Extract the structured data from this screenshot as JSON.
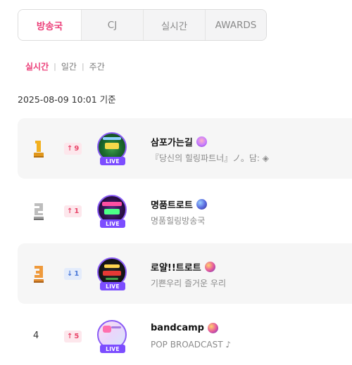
{
  "tabs": [
    {
      "label": "방송국",
      "active": true
    },
    {
      "label": "CJ",
      "active": false
    },
    {
      "label": "실시간",
      "active": false
    },
    {
      "label": "AWARDS",
      "active": false
    }
  ],
  "periods": [
    {
      "label": "실시간",
      "active": true
    },
    {
      "label": "일간",
      "active": false
    },
    {
      "label": "주간",
      "active": false
    }
  ],
  "period_separator": "|",
  "timestamp": "2025-08-09 10:01 기준",
  "live_label": "LIVE",
  "colors": {
    "accent": "#ec407a",
    "rank_up": "#e8476a",
    "rank_down": "#4a78d8",
    "live_badge": "#7c4dff",
    "medal_gold": "#f2b01e",
    "medal_silver": "#9e9e9e",
    "medal_bronze": "#e08a2e"
  },
  "rankings": [
    {
      "rank": "1",
      "medal": "gold",
      "change_dir": "up",
      "change_arrow": "↑",
      "change_value": "9",
      "name": "삼포가는길",
      "name_icon": "people-emoji-icon",
      "description": "『당신의 힐링파트너』ノ。담: ◈"
    },
    {
      "rank": "2",
      "medal": "silver",
      "change_dir": "up",
      "change_arrow": "↑",
      "change_value": "1",
      "name": "명품트로트",
      "name_icon": "planet-emoji-icon",
      "description": "명품힐링방송국"
    },
    {
      "rank": "3",
      "medal": "bronze",
      "change_dir": "down",
      "change_arrow": "↓",
      "change_value": "1",
      "name": "로얄!!트로트",
      "name_icon": "planet-emoji-icon",
      "description": "기쁜우리 즐거운 우리"
    },
    {
      "rank": "4",
      "medal": "",
      "change_dir": "up",
      "change_arrow": "↑",
      "change_value": "5",
      "name": "bandcamp",
      "name_icon": "planet-emoji-icon",
      "description": "POP BROADCAST ♪"
    }
  ]
}
